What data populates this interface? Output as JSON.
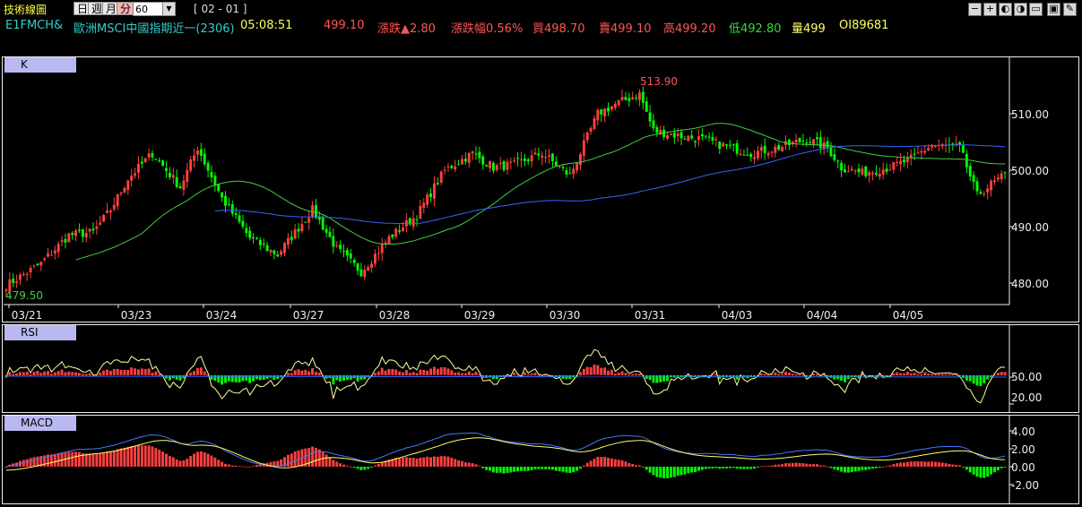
{
  "title": "技術線圖",
  "timeframes": [
    "日",
    "週",
    "月",
    "分"
  ],
  "active_timeframe": "分",
  "interval": "60",
  "period": "[ 02 - 01 ]",
  "toolbar_icons": [
    "minus-icon",
    "plus-icon",
    "zoom-out-icon",
    "zoom-in-icon",
    "chat-icon",
    "save-icon",
    "edit-icon"
  ],
  "quote": {
    "symbol": "E1FMCH&",
    "name": "歐洲MSCI中國指期近一(2306)",
    "time": "05:08:51",
    "last": "499.10",
    "change": "漲跌▲2.80",
    "change_pct": "漲跌幅0.56%",
    "bid": "買498.70",
    "ask": "賣499.10",
    "high": "高499.20",
    "low": "低492.80",
    "volume": "量499",
    "oi": "OI89681"
  },
  "colors": {
    "up": "#ff4040",
    "down": "#00ff00",
    "ma_green": "#44cc44",
    "ma_blue": "#3366ff",
    "dif": "#ffff66",
    "dea": "#4477ff",
    "quote_red": "#ff5555",
    "quote_green": "#33dd33",
    "cyan": "#33cccc",
    "yellow": "#ffff66"
  },
  "chart_data": [
    {
      "name": "K",
      "type": "candlestick",
      "x_labels": [
        "03/21",
        "03/23",
        "03/24",
        "03/27",
        "03/28",
        "03/29",
        "03/30",
        "03/31",
        "04/03",
        "04/04",
        "04/05"
      ],
      "y_ticks": [
        "510.00",
        "500.00",
        "490.00",
        "480.00"
      ],
      "ylim": [
        475,
        520
      ],
      "high_label": "513.90",
      "low_label": "479.50",
      "close_anchors": [
        [
          0,
          479.6
        ],
        [
          5,
          481.5
        ],
        [
          10,
          483.5
        ],
        [
          18,
          488.5
        ],
        [
          25,
          489
        ],
        [
          30,
          493
        ],
        [
          35,
          498.5
        ],
        [
          42,
          503
        ],
        [
          50,
          497
        ],
        [
          55,
          504
        ],
        [
          62,
          495
        ],
        [
          70,
          488
        ],
        [
          78,
          485
        ],
        [
          88,
          493
        ],
        [
          95,
          486
        ],
        [
          102,
          482
        ],
        [
          110,
          488
        ],
        [
          118,
          492
        ],
        [
          126,
          500
        ],
        [
          134,
          503
        ],
        [
          140,
          500.5
        ],
        [
          146,
          501
        ],
        [
          154,
          503
        ],
        [
          162,
          499
        ],
        [
          170,
          510
        ],
        [
          176,
          512
        ],
        [
          182,
          513.5
        ],
        [
          186,
          507
        ],
        [
          194,
          506
        ],
        [
          200,
          505.5
        ],
        [
          208,
          504
        ],
        [
          214,
          503
        ],
        [
          222,
          504
        ],
        [
          230,
          505.5
        ],
        [
          236,
          504
        ],
        [
          240,
          500.5
        ],
        [
          246,
          499.5
        ],
        [
          254,
          500.5
        ],
        [
          260,
          502
        ],
        [
          266,
          504.5
        ],
        [
          274,
          504
        ],
        [
          279,
          495.5
        ],
        [
          283,
          497.5
        ],
        [
          287,
          499.1
        ]
      ],
      "n_bars": 288
    },
    {
      "name": "RSI",
      "type": "line",
      "y_ticks": [
        "50.00",
        "20.00"
      ],
      "ylim": [
        0,
        100
      ]
    },
    {
      "name": "MACD",
      "type": "line+histogram",
      "y_ticks": [
        "4.00",
        "2.00",
        "0.00",
        "-2.00"
      ],
      "ylim": [
        -3,
        5
      ]
    }
  ]
}
